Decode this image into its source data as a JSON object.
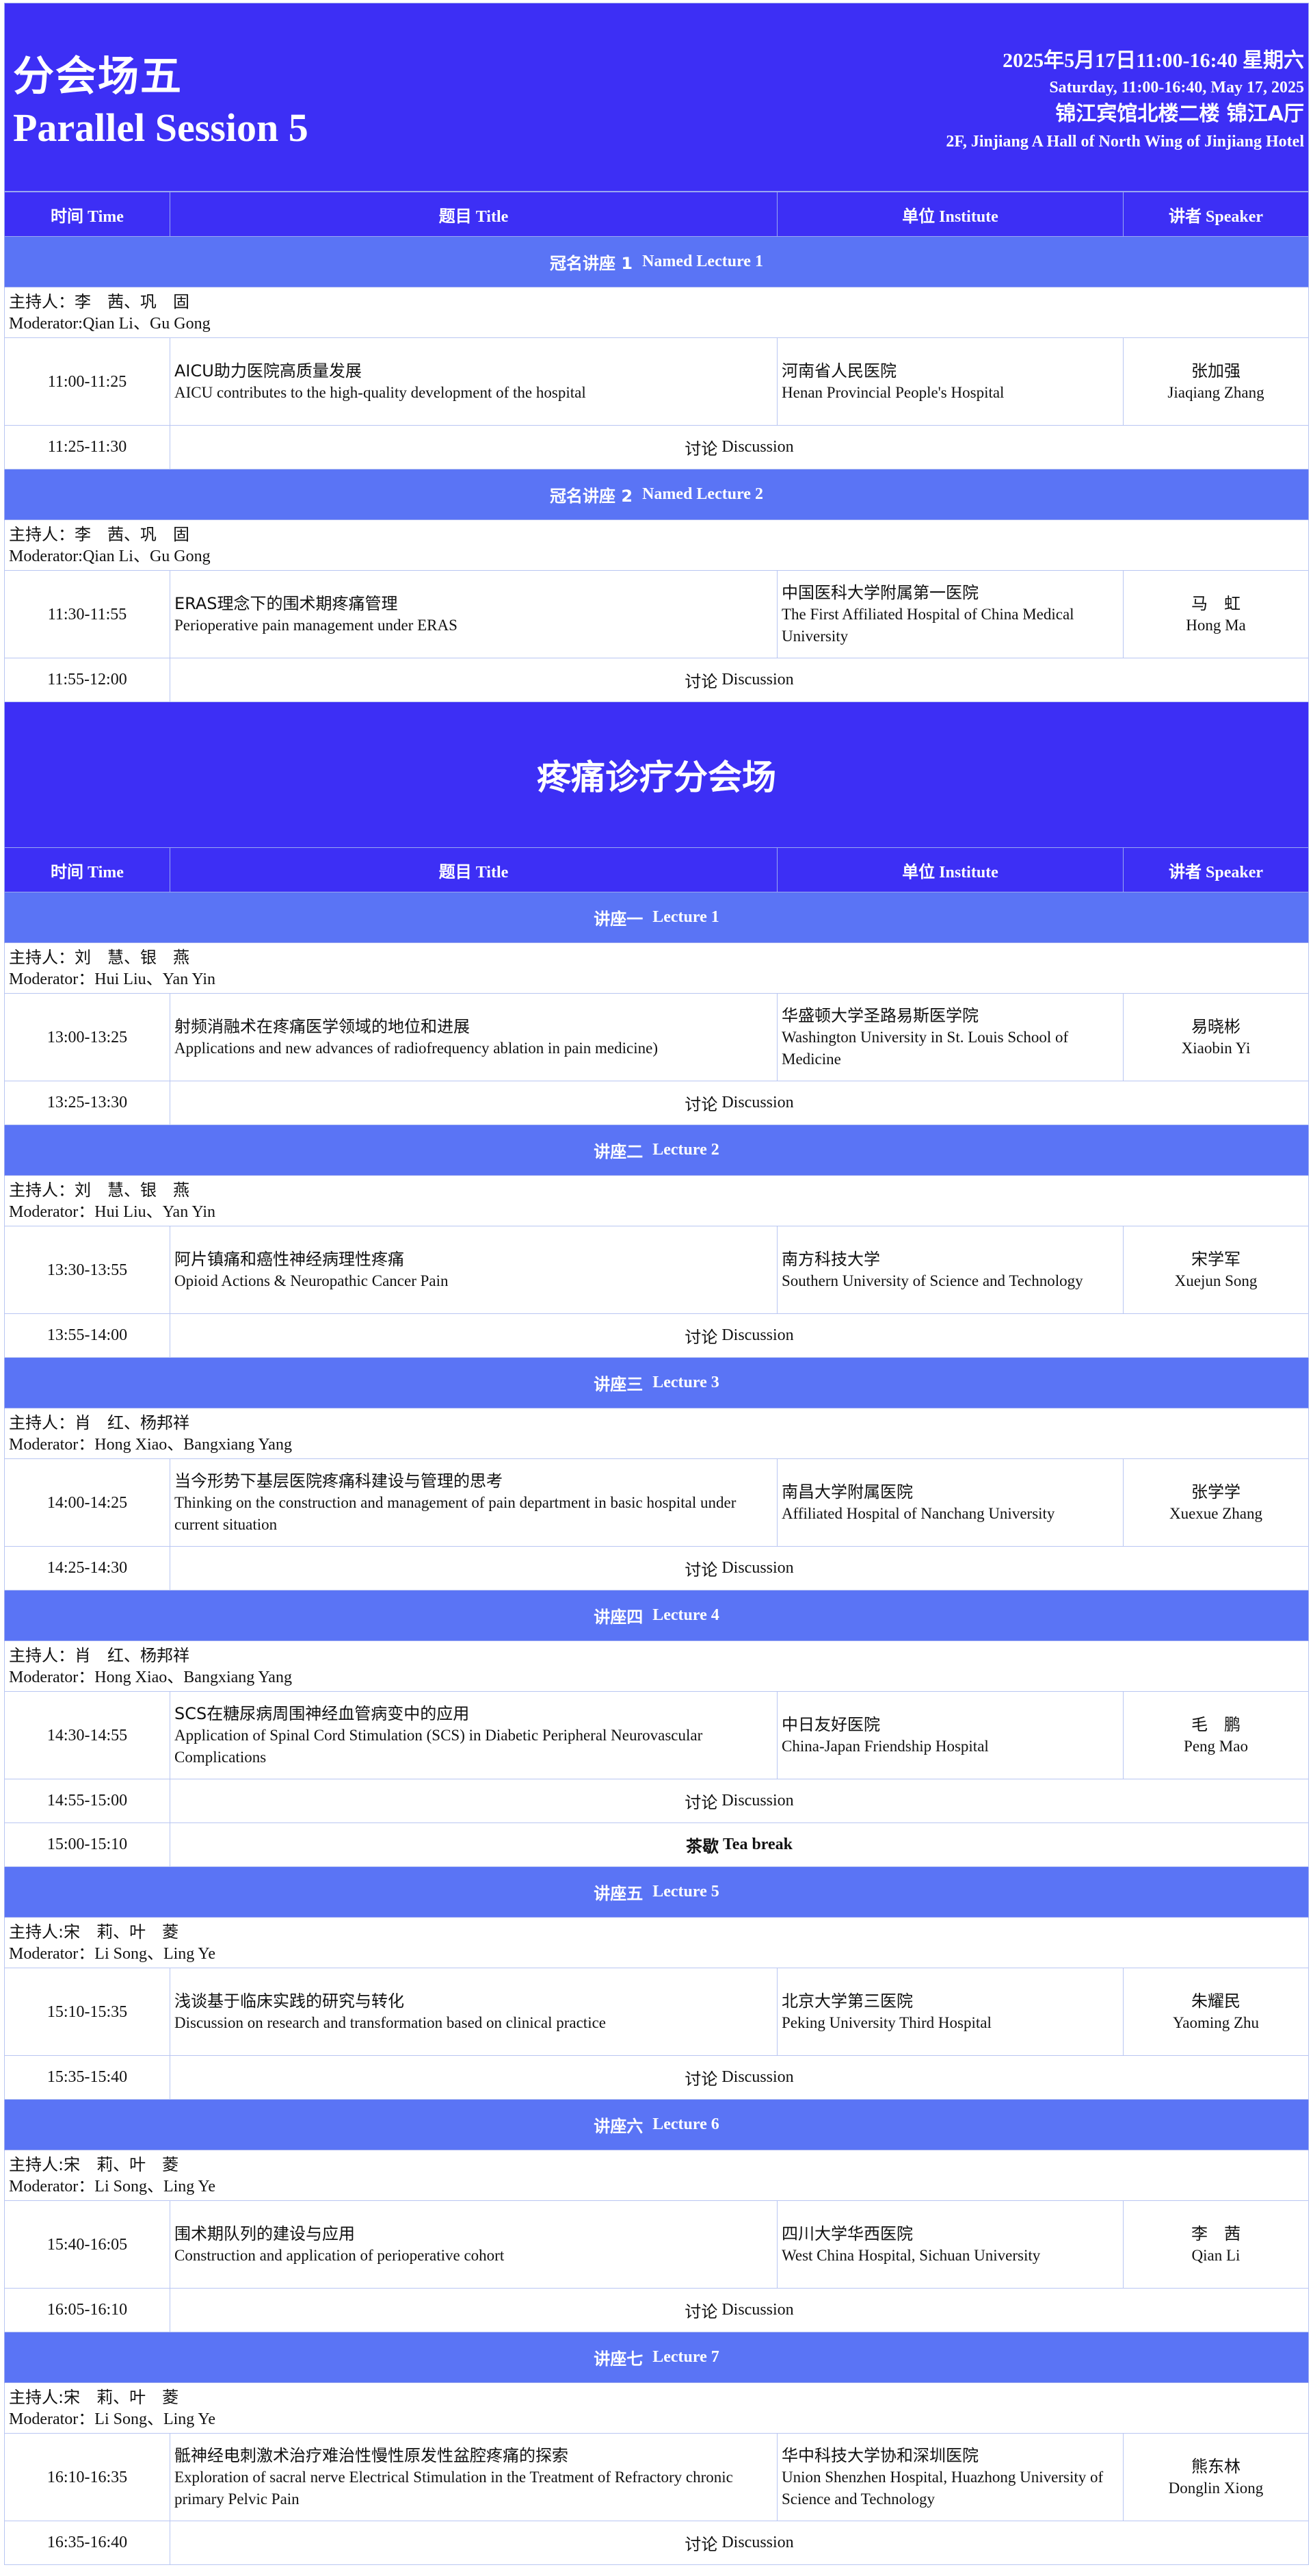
{
  "header": {
    "title_zh": "分会场五",
    "title_en": "Parallel Session 5",
    "date_zh": "2025年5月17日11:00-16:40  星期六",
    "date_en": "Saturday, 11:00-16:40, May 17, 2025",
    "venue_zh": "锦江宾馆北楼二楼 锦江A厅",
    "venue_en": "2F, Jinjiang A Hall of North Wing of Jinjiang Hotel"
  },
  "columns": {
    "time": "时间 Time",
    "title": "题目 Title",
    "institute": "单位 Institute",
    "speaker": "讲者 Speaker"
  },
  "section2_title": "疼痛诊疗分会场",
  "discussion": {
    "zh": "讨论",
    "en": "Discussion"
  },
  "blocks1": [
    {
      "lecture_zh": "冠名讲座 1",
      "lecture_en": "Named Lecture 1",
      "mod_zh": "主持人：李　茜、巩　固",
      "mod_en": "Moderator:Qian Li、Gu Gong",
      "time": "11:00-11:25",
      "title_zh": "AICU助力医院高质量发展",
      "title_en": "AICU contributes to the high-quality development of the hospital",
      "inst_zh": "河南省人民医院",
      "inst_en": "Henan Provincial People's Hospital",
      "spk_zh": "张加强",
      "spk_en": "Jiaqiang Zhang",
      "disc_time": "11:25-11:30"
    },
    {
      "lecture_zh": "冠名讲座 2",
      "lecture_en": "Named Lecture 2",
      "mod_zh": "主持人：李　茜、巩　固",
      "mod_en": "Moderator:Qian Li、Gu Gong",
      "time": "11:30-11:55",
      "title_zh": "ERAS理念下的围术期疼痛管理",
      "title_en": "Perioperative pain management under ERAS",
      "inst_zh": "中国医科大学附属第一医院",
      "inst_en": "The First Affiliated Hospital of China Medical University",
      "spk_zh": "马　虹",
      "spk_en": "Hong Ma",
      "disc_time": "11:55-12:00"
    }
  ],
  "blocks2": [
    {
      "lecture_zh": "讲座一",
      "lecture_en": "Lecture 1",
      "mod_zh": "主持人：刘　慧、银　燕",
      "mod_en": "Moderator：Hui Liu、Yan Yin",
      "time": "13:00-13:25",
      "title_zh": "射频消融术在疼痛医学领域的地位和进展",
      "title_en": "Applications and new advances of radiofrequency ablation in pain medicine)",
      "inst_zh": "华盛顿大学圣路易斯医学院",
      "inst_en": "Washington University in St. Louis School of Medicine",
      "spk_zh": "易晓彬",
      "spk_en": "Xiaobin Yi",
      "disc_time": "13:25-13:30"
    },
    {
      "lecture_zh": "讲座二",
      "lecture_en": "Lecture 2",
      "mod_zh": "主持人：刘　慧、银　燕",
      "mod_en": "Moderator：Hui Liu、Yan Yin",
      "time": "13:30-13:55",
      "title_zh": "阿片镇痛和癌性神经病理性疼痛",
      "title_en": "Opioid Actions & Neuropathic Cancer Pain",
      "inst_zh": "南方科技大学",
      "inst_en": "Southern University of Science and Technology",
      "spk_zh": "宋学军",
      "spk_en": "Xuejun Song",
      "disc_time": "13:55-14:00"
    },
    {
      "lecture_zh": "讲座三",
      "lecture_en": "Lecture 3",
      "mod_zh": "主持人：肖　红、杨邦祥",
      "mod_en": "Moderator：Hong Xiao、Bangxiang Yang",
      "time": "14:00-14:25",
      "title_zh": "当今形势下基层医院疼痛科建设与管理的思考",
      "title_en": "Thinking on the construction and management of pain department in basic hospital under current situation",
      "inst_zh": "南昌大学附属医院",
      "inst_en": "Affiliated Hospital of Nanchang University",
      "spk_zh": "张学学",
      "spk_en": "Xuexue Zhang",
      "disc_time": "14:25-14:30"
    },
    {
      "lecture_zh": "讲座四",
      "lecture_en": "Lecture 4",
      "mod_zh": "主持人：肖　红、杨邦祥",
      "mod_en": "Moderator：Hong Xiao、Bangxiang Yang",
      "time": "14:30-14:55",
      "title_zh": "SCS在糖尿病周围神经血管病变中的应用",
      "title_en": "Application of Spinal Cord Stimulation (SCS) in Diabetic Peripheral Neurovascular Complications",
      "inst_zh": "中日友好医院",
      "inst_en": "China-Japan Friendship Hospital",
      "spk_zh": "毛　鹏",
      "spk_en": "Peng Mao",
      "disc_time": "14:55-15:00",
      "tea_time": "15:00-15:10",
      "tea_zh": "茶歇",
      "tea_en": "Tea break"
    },
    {
      "lecture_zh": "讲座五",
      "lecture_en": "Lecture 5",
      "mod_zh": "主持人:宋　莉、叶　菱",
      "mod_en": "Moderator：Li Song、Ling Ye",
      "time": "15:10-15:35",
      "title_zh": "浅谈基于临床实践的研究与转化",
      "title_en": "Discussion on research and transformation based on clinical practice",
      "inst_zh": "北京大学第三医院",
      "inst_en": "Peking University Third Hospital",
      "spk_zh": "朱耀民",
      "spk_en": "Yaoming Zhu",
      "disc_time": "15:35-15:40"
    },
    {
      "lecture_zh": "讲座六",
      "lecture_en": "Lecture 6",
      "mod_zh": "主持人:宋　莉、叶　菱",
      "mod_en": "Moderator：Li Song、Ling Ye",
      "time": "15:40-16:05",
      "title_zh": "围术期队列的建设与应用",
      "title_en": "Construction and application of perioperative cohort",
      "inst_zh": "四川大学华西医院",
      "inst_en": "West China Hospital, Sichuan University",
      "spk_zh": "李　茜",
      "spk_en": "Qian Li",
      "disc_time": "16:05-16:10"
    },
    {
      "lecture_zh": "讲座七",
      "lecture_en": "Lecture 7",
      "mod_zh": "主持人:宋　莉、叶　菱",
      "mod_en": "Moderator：Li Song、Ling Ye",
      "time": "16:10-16:35",
      "title_zh": "骶神经电刺激术治疗难治性慢性原发性盆腔疼痛的探索",
      "title_en": "Exploration of sacral nerve Electrical Stimulation in the Treatment of Refractory chronic primary Pelvic Pain",
      "inst_zh": "华中科技大学协和深圳医院",
      "inst_en": "Union Shenzhen Hospital, Huazhong University of Science and Technology",
      "spk_zh": "熊东林",
      "spk_en": "Donglin Xiong",
      "disc_time": "16:35-16:40"
    }
  ]
}
